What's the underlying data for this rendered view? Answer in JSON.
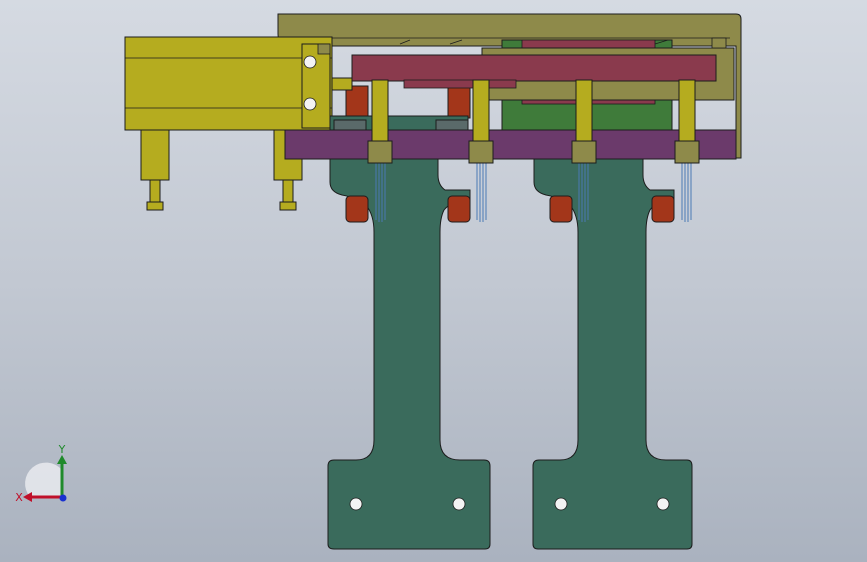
{
  "viewport": {
    "background_top": "#d5dae2",
    "background_bottom": "#aab2bf"
  },
  "triad": {
    "x_label": "X",
    "y_label": "Y",
    "x_color": "#c0102a",
    "y_color": "#1f8a2b",
    "z_color": "#1830d0"
  },
  "colors": {
    "plate_green": "#3a6b5c",
    "cylinder_olive": "#b5ac1f",
    "frame_olive": "#8e8a4a",
    "rail_purple": "#6b3a6b",
    "block_red": "#a3361a",
    "mount_bright_green": "#3f7b3a",
    "slider_maroon": "#8a3a4d",
    "finger_blue": "#4a7ab5"
  }
}
